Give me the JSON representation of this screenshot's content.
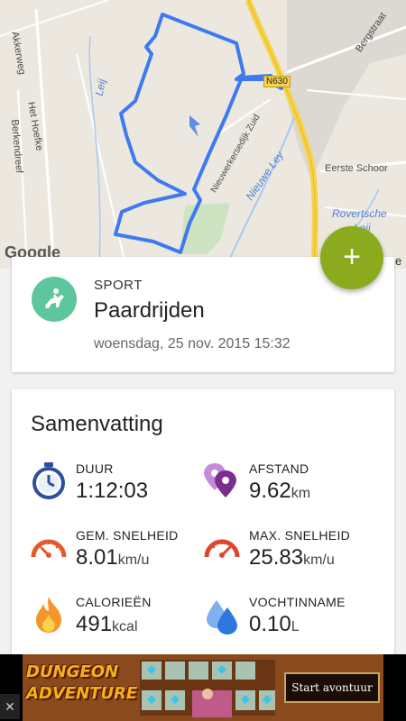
{
  "map": {
    "labels": {
      "akkerweg": "Akkerweg",
      "leij": "Leij",
      "het_hoefke": "Het Hoefke",
      "berkendreef": "Berkendreef",
      "nieuwerkersedijk": "Nieuwerkersedijk Zuid",
      "nieuwe_ley": "Nieuwe Ley",
      "bergstraat": "Bergstraat",
      "eerste_schoor": "Eerste Schoor",
      "rovertsche": "Rovertsche",
      "leij2": "Leij",
      "road_badge": "N630",
      "google": "Google",
      "edge_letter": "e"
    },
    "route_color": "#3d7af2"
  },
  "fab": {
    "label": "+"
  },
  "sport": {
    "label": "SPORT",
    "name": "Paardrijden",
    "date": "woensdag, 25 nov. 2015 15:32",
    "icon": "horse-riding-icon",
    "color": "#5ec69e"
  },
  "summary": {
    "title": "Samenvatting",
    "stats": {
      "duration": {
        "label": "DUUR",
        "value": "1:12:03",
        "unit": "",
        "icon": "stopwatch-icon"
      },
      "distance": {
        "label": "AFSTAND",
        "value": "9.62",
        "unit": "km",
        "icon": "map-pin-icon"
      },
      "avg_speed": {
        "label": "GEM. SNELHEID",
        "value": "8.01",
        "unit": "km/u",
        "icon": "speedometer-icon"
      },
      "max_speed": {
        "label": "MAX. SNELHEID",
        "value": "25.83",
        "unit": "km/u",
        "icon": "speedometer-fast-icon"
      },
      "calories": {
        "label": "CALORIEËN",
        "value": "491",
        "unit": "kcal",
        "icon": "flame-icon"
      },
      "hydration": {
        "label": "VOCHTINNAME",
        "value": "0.10",
        "unit": "L",
        "icon": "water-drops-icon"
      }
    }
  },
  "ad": {
    "title": "DUNGEON ADVENTURE",
    "button": "Start avontuur",
    "close": "✕"
  }
}
